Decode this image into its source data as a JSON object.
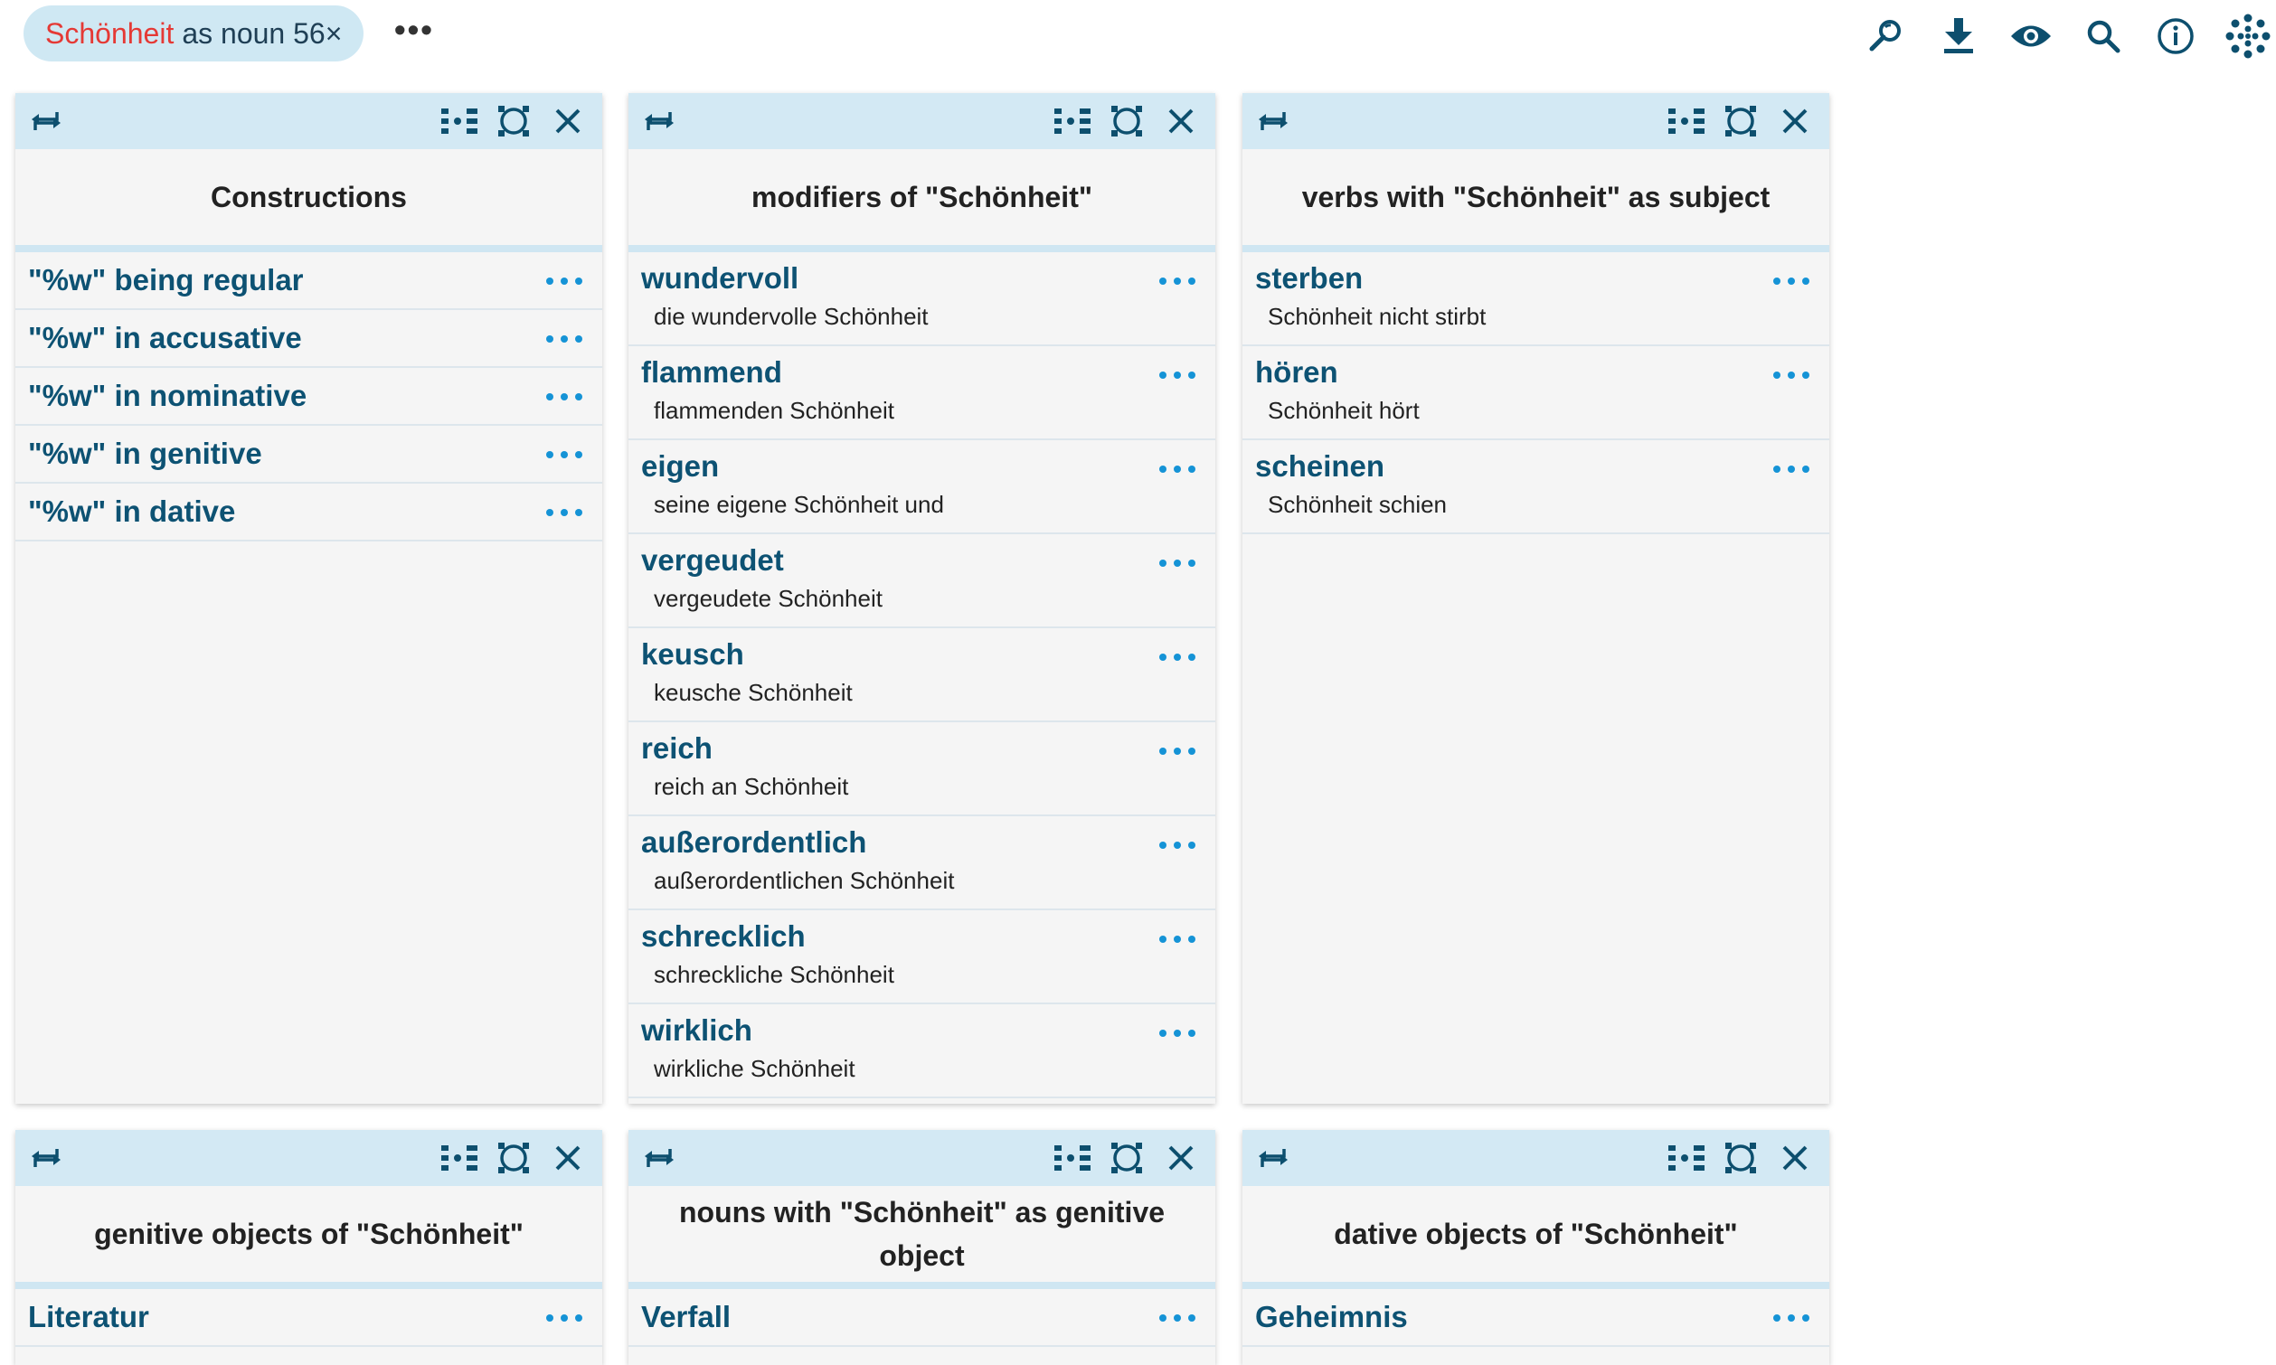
{
  "query": {
    "keyword": "Schönheit",
    "rest": "as noun 56×"
  },
  "topbar": {
    "more": "•••"
  },
  "top_icons": [
    "zoom-search-icon",
    "download-icon",
    "eye-icon",
    "search-icon",
    "info-icon",
    "dots-grid-icon"
  ],
  "colors": {
    "accent": "#0d5273",
    "header_bg": "#d3e9f4",
    "pill_bg": "#cfe8f3",
    "keyword": "#e53935",
    "dots": "#1593d6"
  },
  "panels": [
    {
      "title": "Constructions",
      "rows": [
        {
          "term": "\"%w\" being regular"
        },
        {
          "term": "\"%w\" in accusative"
        },
        {
          "term": "\"%w\" in nominative"
        },
        {
          "term": "\"%w\" in genitive"
        },
        {
          "term": "\"%w\" in dative"
        }
      ]
    },
    {
      "title": "modifiers of \"Schönheit\"",
      "rows": [
        {
          "term": "wundervoll",
          "example": "die wundervolle Schönheit"
        },
        {
          "term": "flammend",
          "example": "flammenden Schönheit"
        },
        {
          "term": "eigen",
          "example": "seine eigene Schönheit und"
        },
        {
          "term": "vergeudet",
          "example": "vergeudete Schönheit"
        },
        {
          "term": "keusch",
          "example": "keusche Schönheit"
        },
        {
          "term": "reich",
          "example": "reich an Schönheit"
        },
        {
          "term": "außerordentlich",
          "example": "außerordentlichen Schönheit"
        },
        {
          "term": "schrecklich",
          "example": "schreckliche Schönheit"
        },
        {
          "term": "wirklich",
          "example": "wirkliche Schönheit"
        }
      ]
    },
    {
      "title": "verbs with \"Schönheit\" as subject",
      "rows": [
        {
          "term": "sterben",
          "example": "Schönheit nicht stirbt"
        },
        {
          "term": "hören",
          "example": "Schönheit hört"
        },
        {
          "term": "scheinen",
          "example": "Schönheit schien"
        }
      ]
    },
    {
      "title": "genitive objects of \"Schönheit\"",
      "rows": [
        {
          "term": "Literatur"
        }
      ]
    },
    {
      "title": "nouns with \"Schönheit\" as genitive object",
      "rows": [
        {
          "term": "Verfall"
        }
      ]
    },
    {
      "title": "dative objects of \"Schönheit\"",
      "rows": [
        {
          "term": "Geheimnis"
        }
      ]
    }
  ]
}
